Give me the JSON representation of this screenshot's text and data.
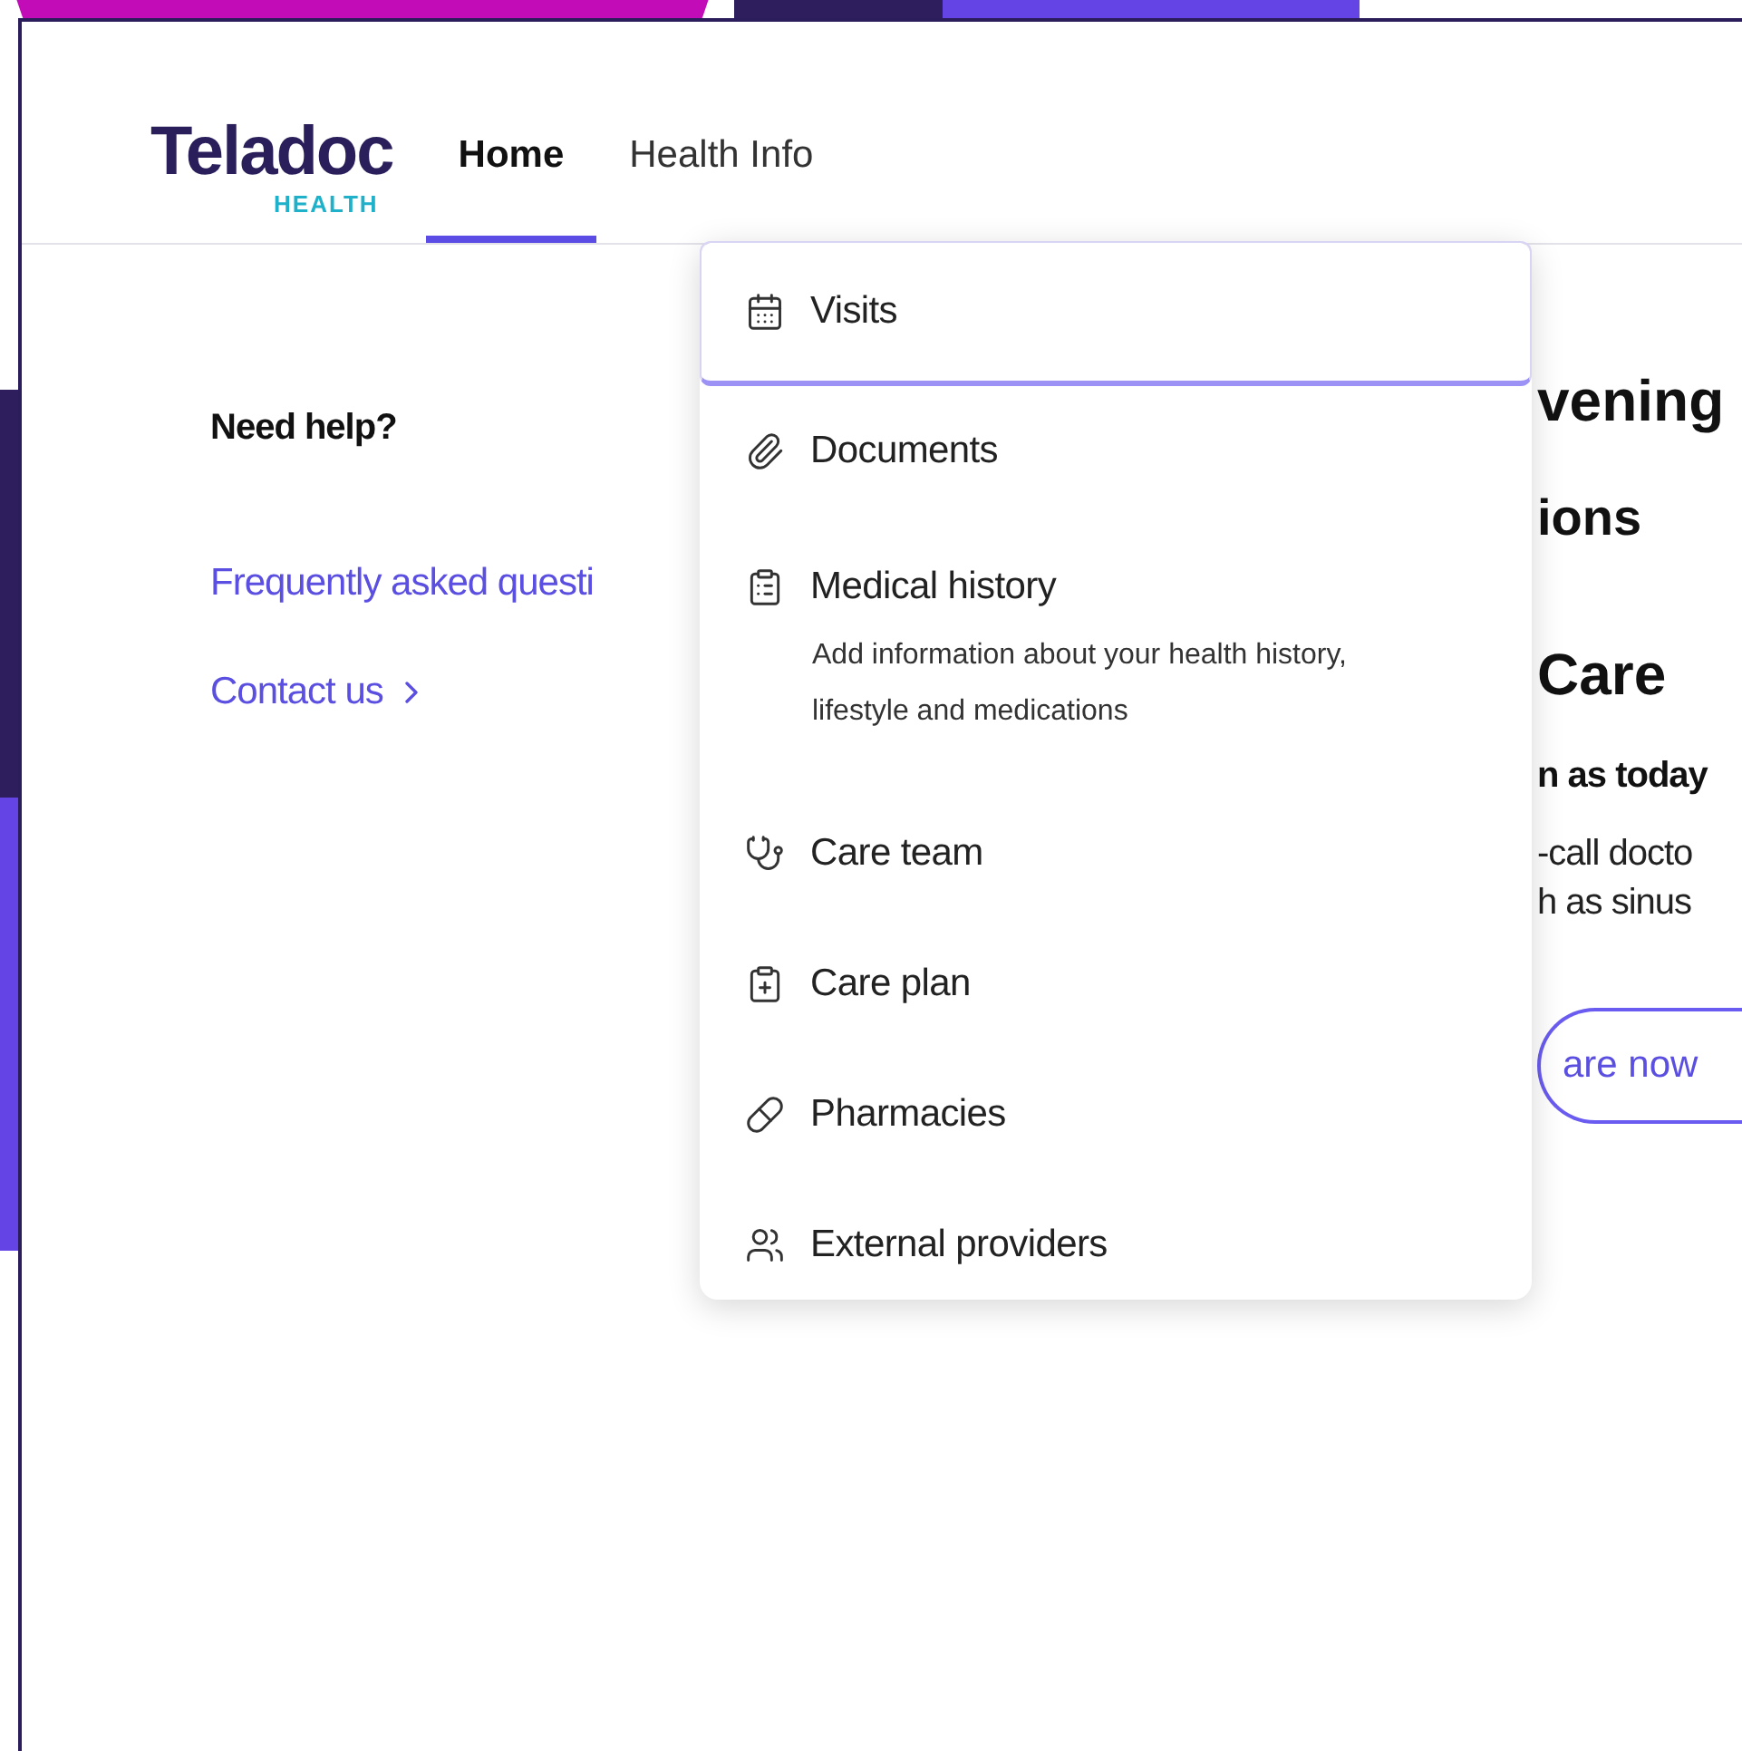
{
  "logo": {
    "name": "Teladoc",
    "tagline": "HEALTH"
  },
  "nav": [
    {
      "label": "Home",
      "selected": true
    },
    {
      "label": "Health Info",
      "selected": false
    }
  ],
  "dropdown": {
    "items": [
      {
        "label": "Visits",
        "selected": true
      },
      {
        "label": "Documents",
        "selected": false
      },
      {
        "label": "Medical history",
        "selected": false,
        "description": "Add information about your health history, lifestyle and medications"
      },
      {
        "label": "Care team",
        "selected": false
      },
      {
        "label": "Care plan",
        "selected": false
      },
      {
        "label": "Pharmacies",
        "selected": false
      },
      {
        "label": "External providers",
        "selected": false
      }
    ]
  },
  "sidebar": {
    "title": "Need help?",
    "links": [
      "Frequently asked questi",
      "Contact us"
    ]
  },
  "main": {
    "greeting": "vening",
    "section_title": "ions",
    "card": {
      "title": "Care",
      "subtitle": "n as today",
      "body": [
        "-call docto",
        "h as sinus"
      ],
      "button": "are now"
    }
  }
}
